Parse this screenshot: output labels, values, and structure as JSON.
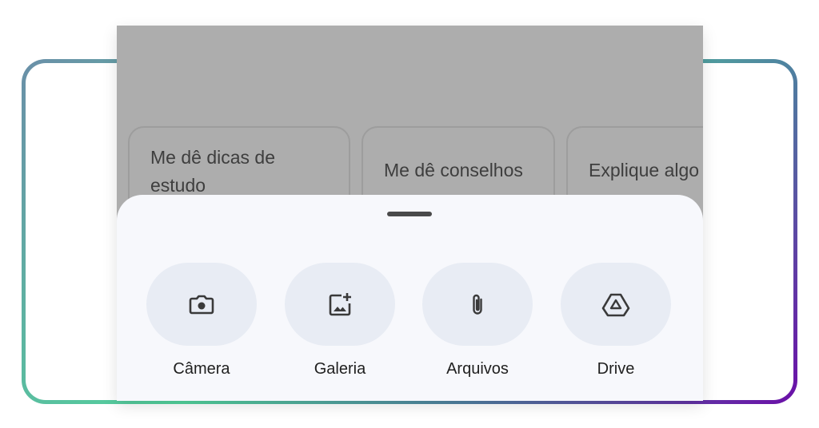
{
  "suggestions": [
    {
      "label": "Me dê dicas de estudo"
    },
    {
      "label": "Me dê conselhos"
    },
    {
      "label": "Explique algo"
    }
  ],
  "attach_sheet": {
    "actions": [
      {
        "label": "Câmera",
        "icon": "camera-icon"
      },
      {
        "label": "Galeria",
        "icon": "gallery-add-icon"
      },
      {
        "label": "Arquivos",
        "icon": "paperclip-icon"
      },
      {
        "label": "Drive",
        "icon": "drive-icon"
      }
    ]
  },
  "colors": {
    "scrim": "#adadad",
    "sheet_background": "#f7f8fc",
    "action_pill": "#e8ecf4",
    "frame_gradient_start": "#52d39c",
    "frame_gradient_end": "#6b0fa8"
  }
}
